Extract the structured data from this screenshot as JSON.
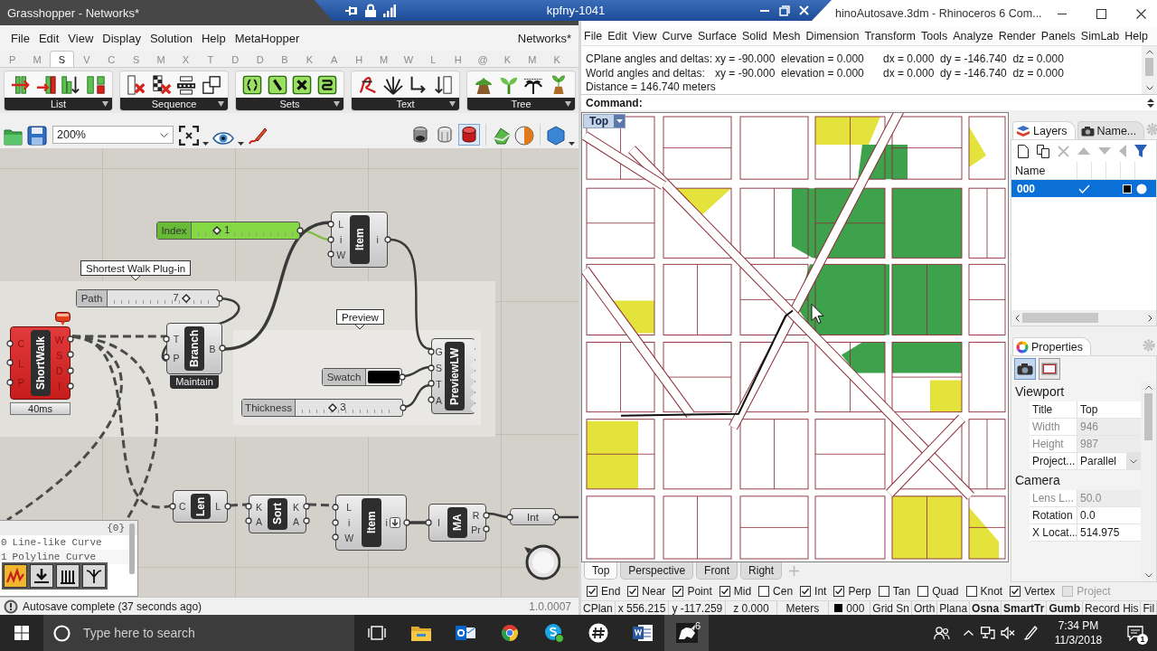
{
  "title_bars": {
    "grasshopper": "Grasshopper - Networks*",
    "remote_session": "kpfny-1041",
    "rhino": "hinoAutosave.3dm - Rhinoceros 6 Com..."
  },
  "grasshopper": {
    "menu": [
      "File",
      "Edit",
      "View",
      "Display",
      "Solution",
      "Help",
      "MetaHopper"
    ],
    "document": "Networks*",
    "tabs": [
      {
        "label": "P",
        "selected": false
      },
      {
        "label": "M",
        "selected": false
      },
      {
        "label": "S",
        "selected": true
      },
      {
        "label": "V",
        "selected": false
      },
      {
        "label": "C",
        "selected": false
      },
      {
        "label": "S",
        "selected": false
      },
      {
        "label": "M",
        "selected": false
      },
      {
        "label": "X",
        "selected": false
      },
      {
        "label": "T",
        "selected": false
      },
      {
        "label": "D",
        "selected": false
      },
      {
        "label": "D",
        "selected": false
      },
      {
        "label": "B",
        "selected": false
      },
      {
        "label": "K",
        "selected": false
      },
      {
        "label": "A",
        "selected": false
      },
      {
        "label": "H",
        "selected": false
      },
      {
        "label": "M",
        "selected": false
      },
      {
        "label": "W",
        "selected": false
      },
      {
        "label": "L",
        "selected": false
      },
      {
        "label": "H",
        "selected": false
      },
      {
        "label": "@",
        "selected": false
      },
      {
        "label": "K",
        "selected": false
      },
      {
        "label": "M",
        "selected": false
      },
      {
        "label": "K",
        "selected": false
      }
    ],
    "ribbon_groups": [
      {
        "label": "List"
      },
      {
        "label": "Sequence"
      },
      {
        "label": "Sets"
      },
      {
        "label": "Text"
      },
      {
        "label": "Tree"
      }
    ],
    "zoom": "200%",
    "preview_modes": [
      {
        "selected": false
      },
      {
        "selected": false
      },
      {
        "selected": true
      }
    ],
    "callouts": [
      {
        "text": "Shortest Walk Plug-in"
      },
      {
        "text": "Preview"
      }
    ],
    "sliders": [
      {
        "label": "Index",
        "value": "1",
        "level": 0.2,
        "selected": true
      },
      {
        "label": "Path",
        "value": "7",
        "level": 0.73,
        "selected": false
      },
      {
        "label": "Thickness",
        "value": "3",
        "level": 0.33,
        "selected": false
      }
    ],
    "swatch": {
      "label": "Swatch",
      "color": "#000000"
    },
    "components": [
      {
        "name": "Item",
        "inputs": [
          "L",
          "i",
          "W"
        ],
        "outputs": [
          "i"
        ],
        "error": false,
        "flatten": false
      },
      {
        "name": "ShortWalk",
        "inputs": [
          "C",
          "L",
          "P"
        ],
        "outputs": [
          "W",
          "S",
          "D",
          "I"
        ],
        "error": true,
        "runtime": "40ms",
        "flatten": false
      },
      {
        "name": "Branch",
        "inputs": [
          "T",
          "P"
        ],
        "outputs": [
          "B"
        ],
        "error": false,
        "message": "Maintain",
        "flatten": false
      },
      {
        "name": "PreviewLW",
        "inputs": [
          "G",
          "S",
          "T",
          "A"
        ],
        "error": false,
        "flatten": false
      },
      {
        "name": "Len",
        "inputs": [
          "C"
        ],
        "outputs": [
          "L"
        ],
        "error": false,
        "flatten": false
      },
      {
        "name": "Sort",
        "inputs": [
          "K",
          "A"
        ],
        "outputs": [
          "K",
          "A"
        ],
        "error": false,
        "flatten": false
      },
      {
        "name": "Item",
        "inputs": [
          "L",
          "i",
          "W"
        ],
        "outputs": [
          "i"
        ],
        "error": false,
        "flatten": true
      },
      {
        "name": "MA",
        "inputs": [
          "I"
        ],
        "outputs": [
          "R",
          "Pr"
        ],
        "error": false,
        "flatten": false
      }
    ],
    "params": [
      {
        "label": "Int"
      }
    ],
    "panel": {
      "path": "{0}",
      "rows": [
        {
          "index": "0",
          "text": "Line-like Curve"
        },
        {
          "index": "1",
          "text": "Polyline Curve"
        }
      ]
    },
    "canvas_tools": [
      {
        "selected": true
      },
      {
        "selected": false
      },
      {
        "selected": false
      },
      {
        "selected": false
      }
    ],
    "status": "Autosave complete (37 seconds ago)",
    "version": "1.0.0007"
  },
  "rhino": {
    "menu": [
      "File",
      "Edit",
      "View",
      "Curve",
      "Surface",
      "Solid",
      "Mesh",
      "Dimension",
      "Transform",
      "Tools",
      "Analyze",
      "Render",
      "Panels",
      "SimLab",
      "Help"
    ],
    "history": [
      [
        "CPlane angles and deltas:",
        "xy = -90.000  elevation = 0.000",
        "dx = 0.000  dy = -146.740  dz = 0.000"
      ],
      [
        "World angles and deltas:",
        "xy = -90.000  elevation = 0.000",
        "dx = 0.000  dy = -146.740  dz = 0.000"
      ],
      [
        "Distance = 146.740 meters"
      ]
    ],
    "prompt": "Command:",
    "viewport_title": "Top",
    "layers_panel": {
      "tabs": [
        {
          "label": "Layers",
          "selected": true
        },
        {
          "label": "Name...",
          "selected": false
        }
      ],
      "column": "Name",
      "layers": [
        {
          "name": "000",
          "selected": true,
          "current": true,
          "color": "#000000"
        }
      ]
    },
    "properties": {
      "title": "Properties",
      "pages": [
        {
          "selected": true
        },
        {
          "selected": false
        }
      ],
      "sections": [
        {
          "title": "Viewport",
          "rows": [
            {
              "label": "Title",
              "value": "Top",
              "disabled": false,
              "kind": "text"
            },
            {
              "label": "Width",
              "value": "946",
              "disabled": true,
              "kind": "text"
            },
            {
              "label": "Height",
              "value": "987",
              "disabled": true,
              "kind": "text"
            },
            {
              "label": "Project...",
              "value": "Parallel",
              "disabled": false,
              "kind": "dropdown"
            }
          ]
        },
        {
          "title": "Camera",
          "rows": [
            {
              "label": "Lens L...",
              "value": "50.0",
              "disabled": true,
              "kind": "text"
            },
            {
              "label": "Rotation",
              "value": "0.0",
              "disabled": false,
              "kind": "text"
            },
            {
              "label": "X Locat...",
              "value": "514.975",
              "disabled": false,
              "kind": "text"
            }
          ]
        }
      ]
    },
    "view_tabs": [
      {
        "label": "Top",
        "selected": true
      },
      {
        "label": "Perspective",
        "selected": false
      },
      {
        "label": "Front",
        "selected": false
      },
      {
        "label": "Right",
        "selected": false
      }
    ],
    "osnaps": [
      {
        "label": "End",
        "checked": true,
        "disabled": false
      },
      {
        "label": "Near",
        "checked": true,
        "disabled": false
      },
      {
        "label": "Point",
        "checked": true,
        "disabled": false
      },
      {
        "label": "Mid",
        "checked": true,
        "disabled": false
      },
      {
        "label": "Cen",
        "checked": false,
        "disabled": false
      },
      {
        "label": "Int",
        "checked": true,
        "disabled": false
      },
      {
        "label": "Perp",
        "checked": true,
        "disabled": false
      },
      {
        "label": "Tan",
        "checked": false,
        "disabled": false
      },
      {
        "label": "Quad",
        "checked": false,
        "disabled": false
      },
      {
        "label": "Knot",
        "checked": false,
        "disabled": false
      },
      {
        "label": "Vertex",
        "checked": true,
        "disabled": false
      },
      {
        "label": "Project",
        "checked": false,
        "disabled": true
      }
    ],
    "status_bar": {
      "cplane": "CPlan",
      "x": "x 556.215",
      "y": "y -117.259",
      "z": "z 0.000",
      "units": "Meters",
      "layer": {
        "name": "000",
        "color": "#000000"
      },
      "toggles": [
        {
          "label": "Grid Sn",
          "on": false
        },
        {
          "label": "Orth",
          "on": false
        },
        {
          "label": "Plana",
          "on": false
        },
        {
          "label": "Osna",
          "on": true
        },
        {
          "label": "SmartTr",
          "on": true
        },
        {
          "label": "Gumb",
          "on": true
        },
        {
          "label": "Record His",
          "on": false
        },
        {
          "label": "Fil",
          "on": false
        }
      ]
    }
  },
  "taskbar": {
    "search": {
      "placeholder": "Type here to search"
    },
    "apps": [
      {
        "kind": "files",
        "active": false
      },
      {
        "kind": "mail",
        "active": false
      },
      {
        "kind": "browser",
        "active": false
      },
      {
        "kind": "chat",
        "active": false
      },
      {
        "kind": "hub",
        "active": false
      },
      {
        "kind": "word",
        "active": false
      },
      {
        "kind": "rhino",
        "active": true,
        "label": "6"
      }
    ],
    "time": "7:34 PM",
    "date": "11/3/2018",
    "notifications": "1"
  }
}
